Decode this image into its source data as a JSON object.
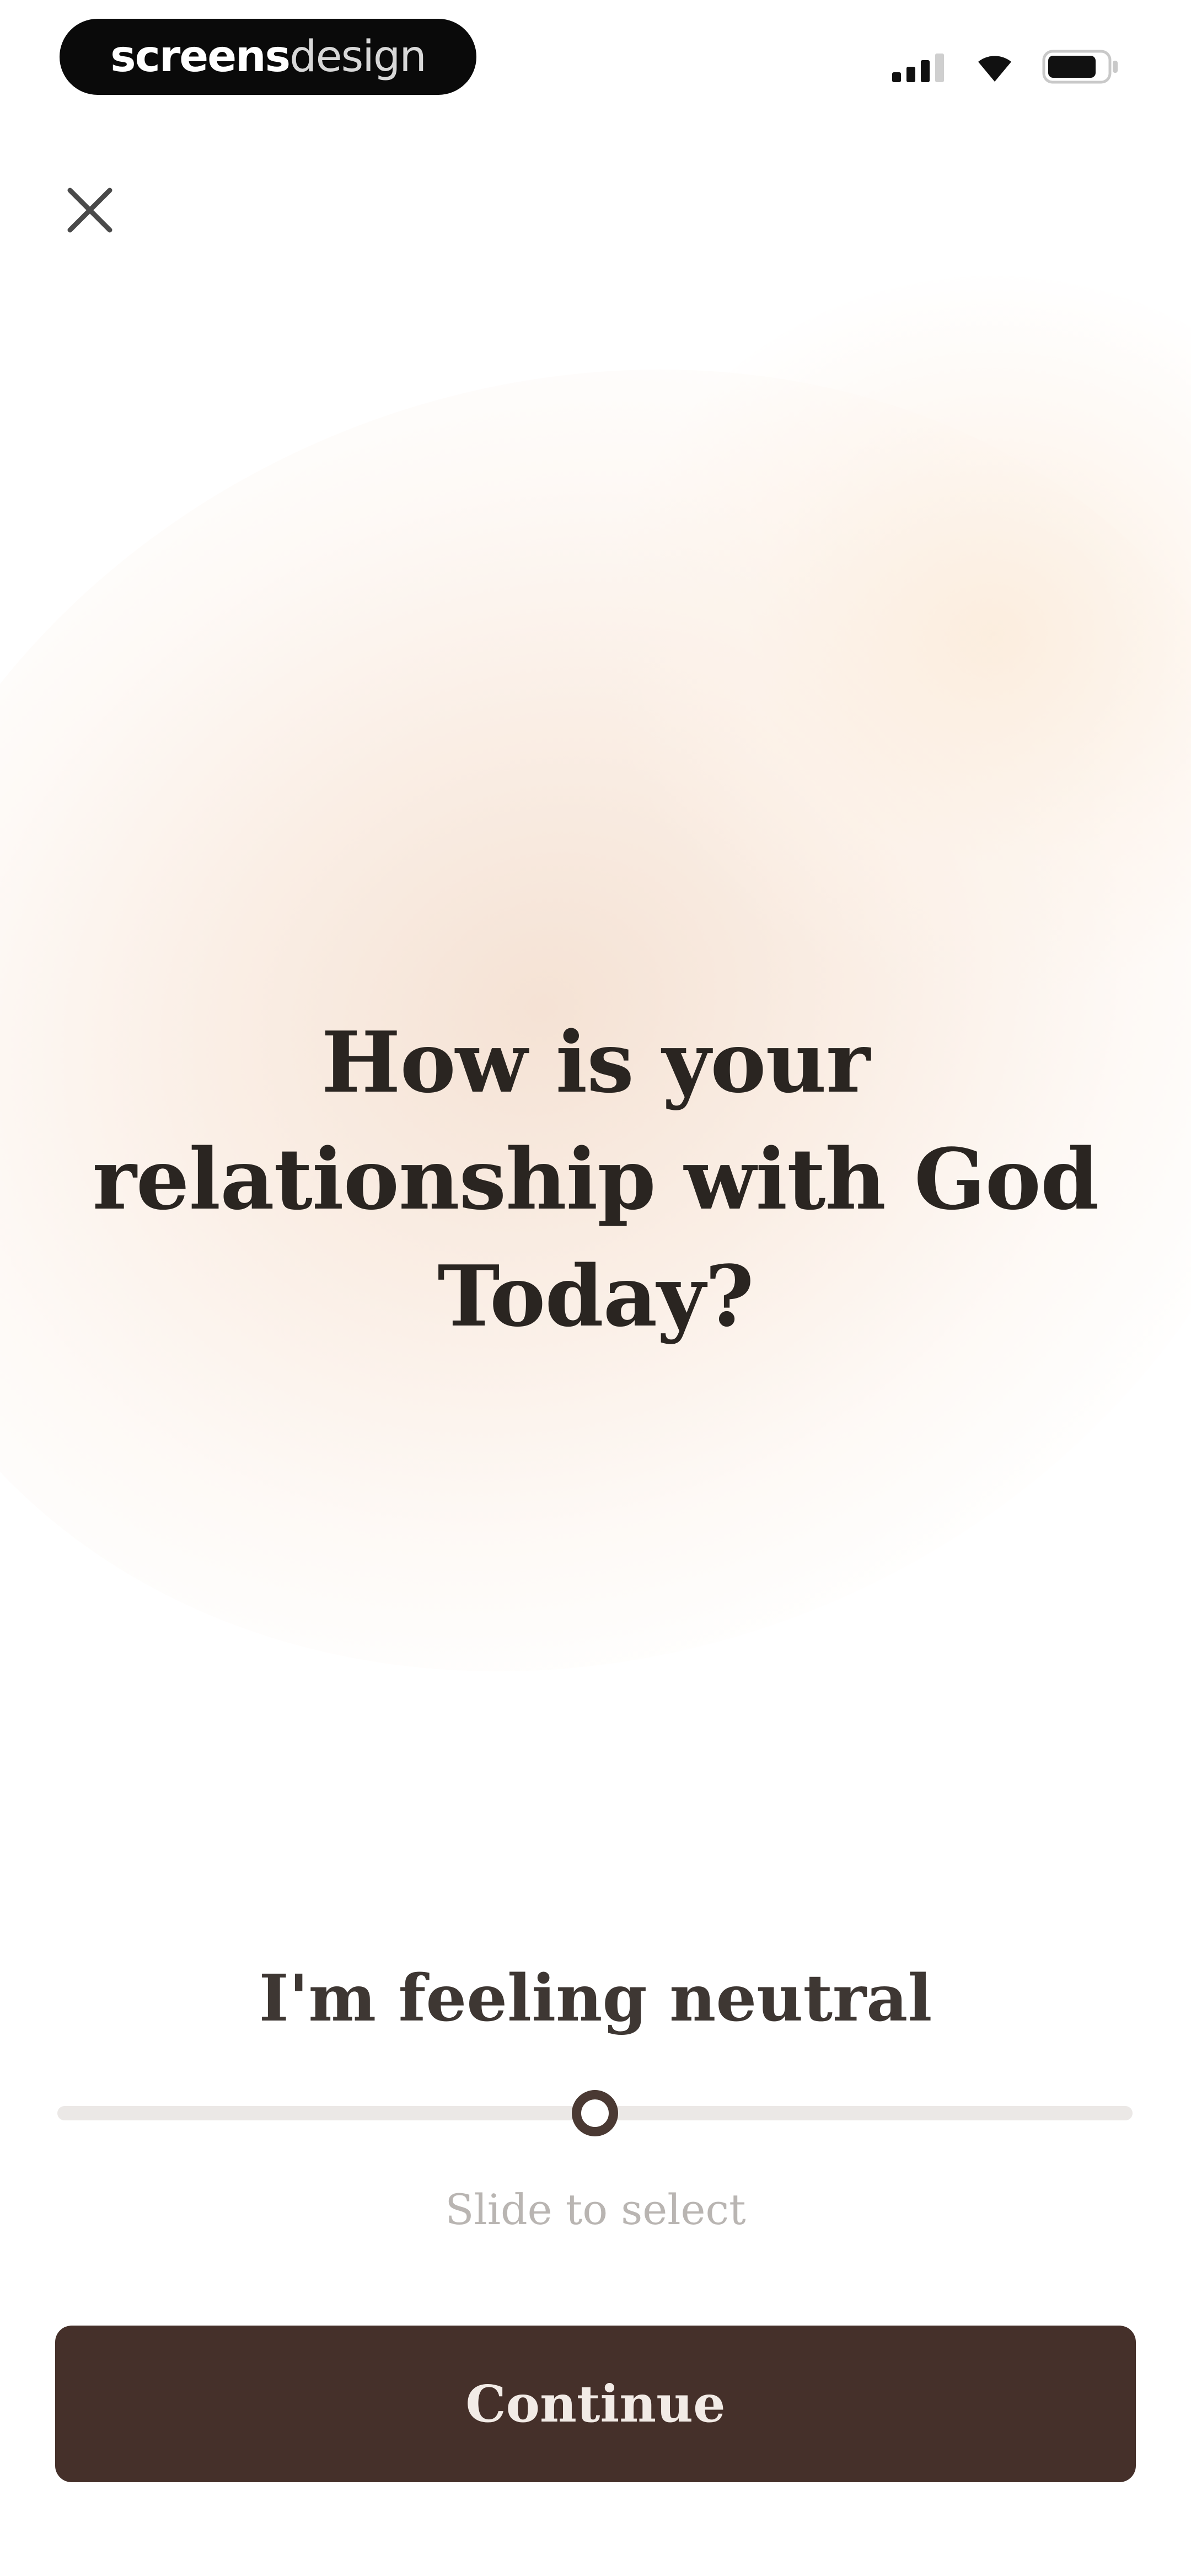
{
  "status_bar": {
    "brand_bold": "screens",
    "brand_light": "design",
    "signal_icon": "cellular-signal-icon",
    "wifi_icon": "wifi-icon",
    "battery_icon": "battery-icon"
  },
  "header": {
    "close_icon": "close-icon"
  },
  "question": {
    "line1": "How is your",
    "line2": "relationship with God",
    "line3": "Today?"
  },
  "mood": {
    "label": "I'm feeling neutral",
    "slider_value": 0.5,
    "hint": "Slide to select"
  },
  "footer": {
    "continue_label": "Continue"
  },
  "colors": {
    "primary": "#45302a",
    "text": "#2a2521",
    "track": "#ebe8e6",
    "glow": "#f3ddcd"
  }
}
